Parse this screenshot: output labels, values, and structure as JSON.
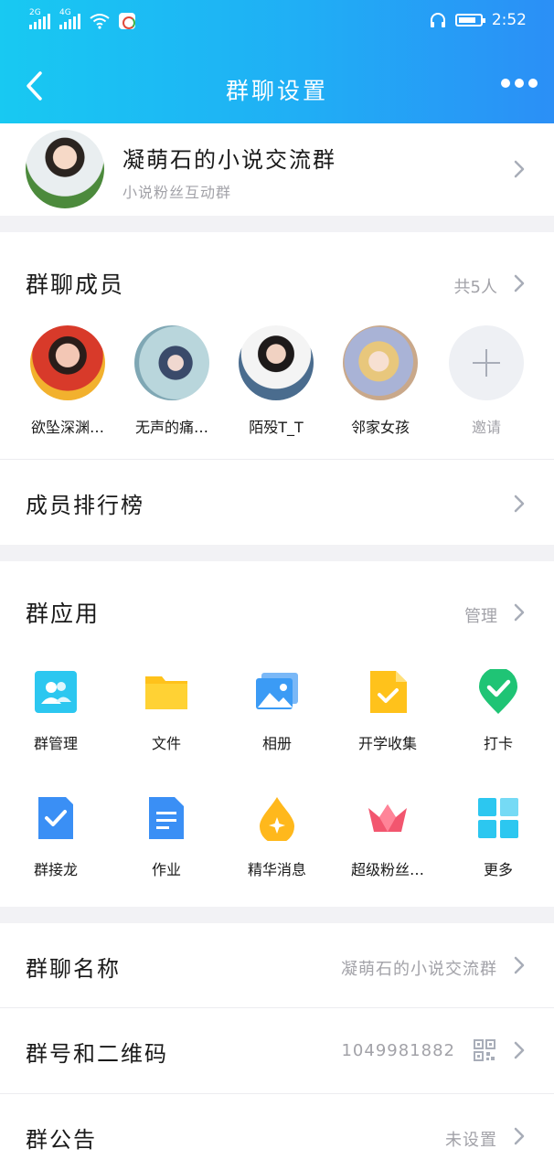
{
  "status_bar": {
    "sig1": "2G",
    "sig2": "4G",
    "time": "2:52"
  },
  "nav": {
    "title": "群聊设置"
  },
  "group": {
    "name": "凝萌石的小说交流群",
    "subtitle": "小说粉丝互动群"
  },
  "members": {
    "title": "群聊成员",
    "count": "共5人",
    "items": [
      {
        "name": "欲坠深渊…"
      },
      {
        "name": "无声的痛…"
      },
      {
        "name": "陌殁T_T"
      },
      {
        "name": "邻家女孩"
      },
      {
        "name": "邀请"
      }
    ]
  },
  "rank": {
    "label": "成员排行榜"
  },
  "apps": {
    "title": "群应用",
    "manage": "管理",
    "items": [
      {
        "label": "群管理",
        "icon": "group-admin-icon"
      },
      {
        "label": "文件",
        "icon": "folder-icon"
      },
      {
        "label": "相册",
        "icon": "photo-album-icon"
      },
      {
        "label": "开学收集",
        "icon": "collect-form-icon"
      },
      {
        "label": "打卡",
        "icon": "check-in-icon"
      },
      {
        "label": "群接龙",
        "icon": "relay-icon"
      },
      {
        "label": "作业",
        "icon": "homework-icon"
      },
      {
        "label": "精华消息",
        "icon": "essence-message-icon"
      },
      {
        "label": "超级粉丝…",
        "icon": "super-fans-icon"
      },
      {
        "label": "更多",
        "icon": "more-apps-icon"
      }
    ]
  },
  "settings": {
    "group_name_label": "群聊名称",
    "group_name_value": "凝萌石的小说交流群",
    "group_id_label": "群号和二维码",
    "group_id_value": "1049981882",
    "notice_label": "群公告",
    "notice_value": "未设置"
  },
  "colors": {
    "accent": "#20aef5",
    "header_start": "#18c9f2",
    "header_end": "#2b8ff6"
  }
}
